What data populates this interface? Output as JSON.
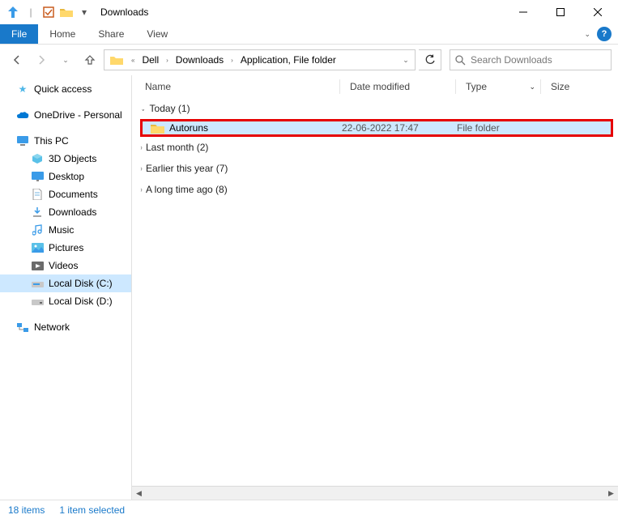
{
  "title": "Downloads",
  "menu": {
    "file": "File",
    "home": "Home",
    "share": "Share",
    "view": "View"
  },
  "breadcrumb": [
    "Dell",
    "Downloads",
    "Application, File folder"
  ],
  "search_placeholder": "Search Downloads",
  "columns": {
    "name": "Name",
    "date": "Date modified",
    "type": "Type",
    "size": "Size"
  },
  "sidebar": {
    "quick": "Quick access",
    "onedrive": "OneDrive - Personal",
    "thispc": "This PC",
    "items": [
      "3D Objects",
      "Desktop",
      "Documents",
      "Downloads",
      "Music",
      "Pictures",
      "Videos",
      "Local Disk (C:)",
      "Local Disk (D:)"
    ],
    "network": "Network"
  },
  "groups": {
    "today": "Today (1)",
    "lastmonth": "Last month (2)",
    "earlier": "Earlier this year (7)",
    "longago": "A long time ago (8)"
  },
  "file": {
    "name": "Autoruns",
    "date": "22-06-2022 17:47",
    "type": "File folder"
  },
  "status": {
    "count": "18 items",
    "selected": "1 item selected"
  }
}
